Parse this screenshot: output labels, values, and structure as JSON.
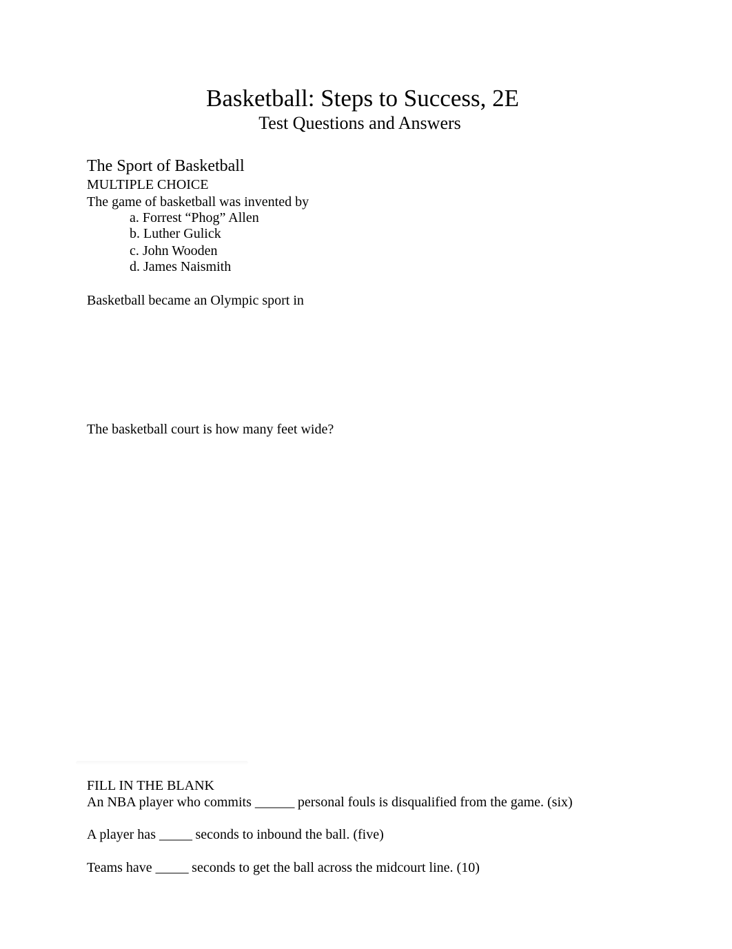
{
  "document": {
    "title": "Basketball: Steps to Success, 2E",
    "subtitle": "Test Questions and Answers"
  },
  "section": {
    "title": "The Sport of Basketball"
  },
  "multiple_choice": {
    "heading": "MULTIPLE CHOICE",
    "questions": [
      {
        "prompt": "The game of basketball was invented by",
        "options": [
          "a. Forrest “Phog” Allen",
          "b. Luther Gulick",
          "c. John Wooden",
          "d. James Naismith"
        ]
      },
      {
        "prompt": "Basketball became an Olympic sport in"
      },
      {
        "prompt": "The basketball court is how many feet wide?"
      }
    ]
  },
  "fill_in_the_blank": {
    "heading": "FILL IN THE BLANK",
    "questions": [
      {
        "before": "An NBA player who commits ",
        "blank": "______",
        "after": " personal fouls is disqualified from the game.",
        "answer": " (six)"
      },
      {
        "before": "A player has ",
        "blank": "_____",
        "after": " seconds to inbound the ball.",
        "answer": " (five)"
      },
      {
        "before": "Teams have ",
        "blank": "_____",
        "after": " seconds to get the ball across the midcourt line.",
        "answer": " (10)"
      }
    ]
  }
}
